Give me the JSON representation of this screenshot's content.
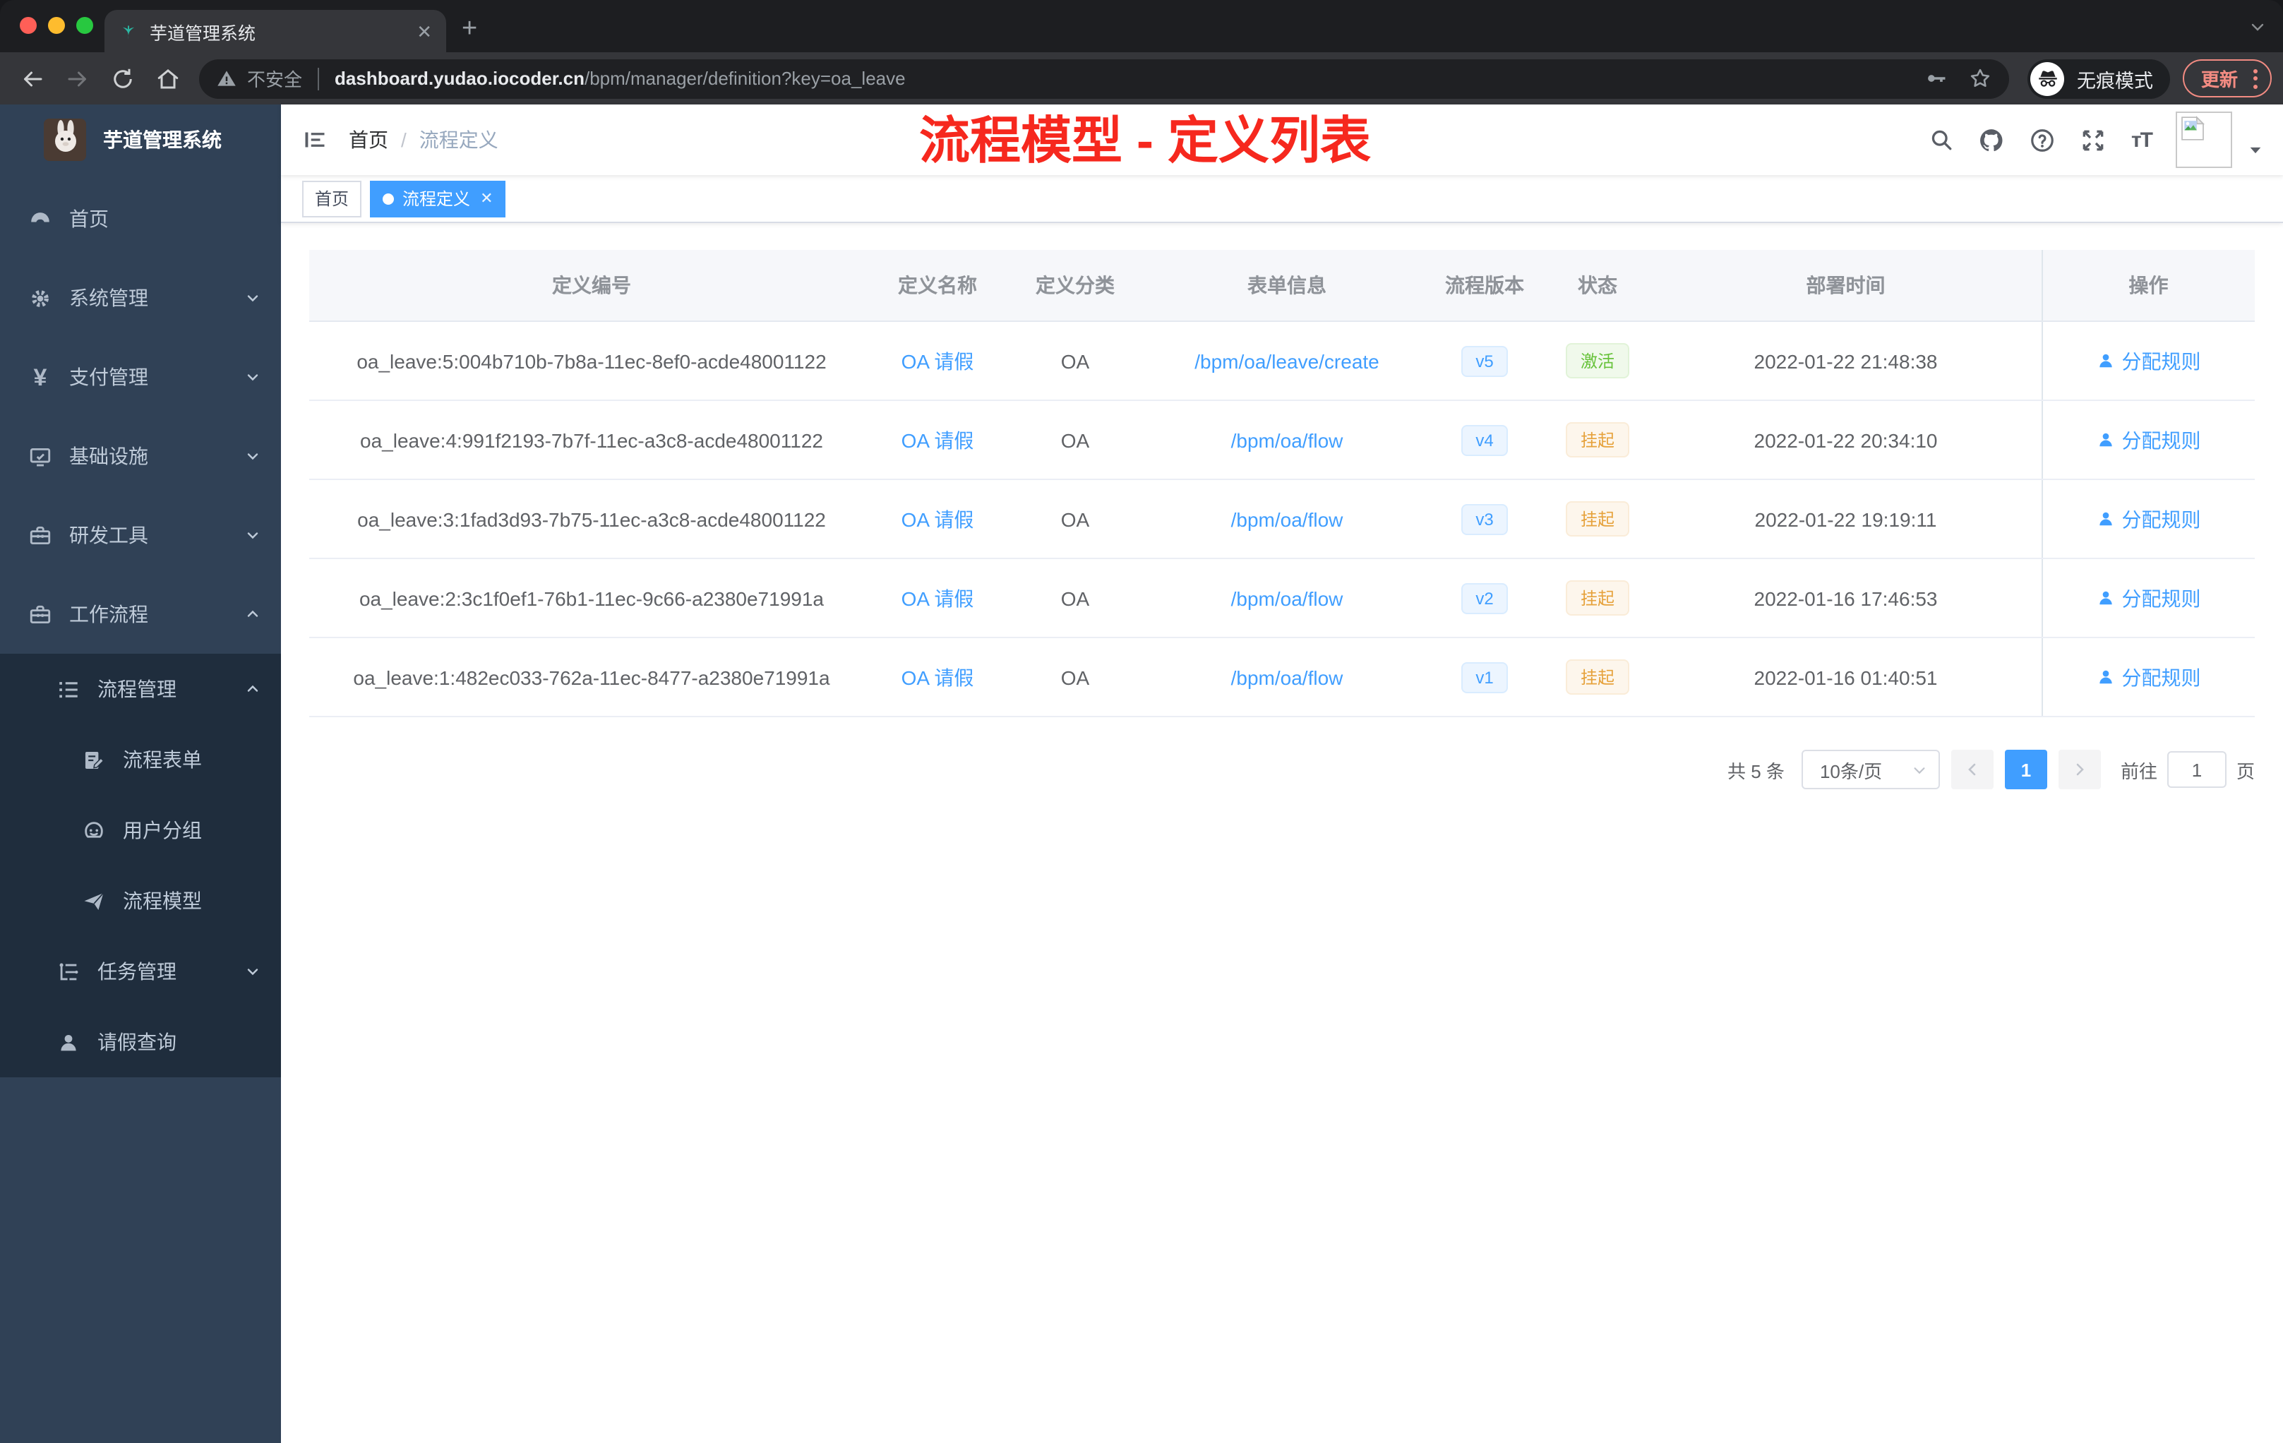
{
  "browser": {
    "tab": {
      "title": "芋道管理系统"
    },
    "toolbar": {
      "security_text": "不安全",
      "url_domain": "dashboard.yudao.iocoder.cn",
      "url_path": "/bpm/manager/definition?key=oa_leave",
      "incognito_label": "无痕模式",
      "update_label": "更新"
    }
  },
  "sidebar": {
    "app_title": "芋道管理系统",
    "items": [
      {
        "key": "home",
        "label": "首页",
        "icon": "dashboard-icon"
      },
      {
        "key": "system",
        "label": "系统管理",
        "icon": "gear-icon",
        "chevron": "down"
      },
      {
        "key": "payment",
        "label": "支付管理",
        "icon": "yen-icon",
        "chevron": "down"
      },
      {
        "key": "infra",
        "label": "基础设施",
        "icon": "monitor-icon",
        "chevron": "down"
      },
      {
        "key": "devtools",
        "label": "研发工具",
        "icon": "toolbox-icon",
        "chevron": "down"
      },
      {
        "key": "workflow",
        "label": "工作流程",
        "icon": "briefcase-icon",
        "chevron": "up"
      }
    ],
    "workflow_children": [
      {
        "key": "process-mgmt",
        "label": "流程管理",
        "icon": "list-icon",
        "chevron": "up",
        "level": 2
      },
      {
        "key": "process-form",
        "label": "流程表单",
        "icon": "form-icon",
        "level": 3
      },
      {
        "key": "user-group",
        "label": "用户分组",
        "icon": "robot-icon",
        "level": 3
      },
      {
        "key": "process-model",
        "label": "流程模型",
        "icon": "plane-icon",
        "level": 3
      },
      {
        "key": "task-mgmt",
        "label": "任务管理",
        "icon": "tree-icon",
        "chevron": "down",
        "level": 2
      },
      {
        "key": "leave-query",
        "label": "请假查询",
        "icon": "user-icon",
        "level": 2
      }
    ]
  },
  "header": {
    "breadcrumb": {
      "home": "首页",
      "separator": "/",
      "current": "流程定义"
    },
    "annotation": "流程模型 - 定义列表",
    "annotation_color": "#f6281e"
  },
  "tags_view": {
    "tabs": [
      {
        "label": "首页",
        "active": false
      },
      {
        "label": "流程定义",
        "active": true,
        "closable": true
      }
    ]
  },
  "table": {
    "columns": [
      "定义编号",
      "定义名称",
      "定义分类",
      "表单信息",
      "流程版本",
      "状态",
      "部署时间",
      "操作"
    ],
    "rows": [
      {
        "id": "oa_leave:5:004b710b-7b8a-11ec-8ef0-acde48001122",
        "name": "OA 请假",
        "category": "OA",
        "form": "/bpm/oa/leave/create",
        "version": "v5",
        "status": "激活",
        "status_type": "success",
        "deploy_time": "2022-01-22 21:48:38",
        "action": "分配规则"
      },
      {
        "id": "oa_leave:4:991f2193-7b7f-11ec-a3c8-acde48001122",
        "name": "OA 请假",
        "category": "OA",
        "form": "/bpm/oa/flow",
        "version": "v4",
        "status": "挂起",
        "status_type": "warning",
        "deploy_time": "2022-01-22 20:34:10",
        "action": "分配规则"
      },
      {
        "id": "oa_leave:3:1fad3d93-7b75-11ec-a3c8-acde48001122",
        "name": "OA 请假",
        "category": "OA",
        "form": "/bpm/oa/flow",
        "version": "v3",
        "status": "挂起",
        "status_type": "warning",
        "deploy_time": "2022-01-22 19:19:11",
        "action": "分配规则"
      },
      {
        "id": "oa_leave:2:3c1f0ef1-76b1-11ec-9c66-a2380e71991a",
        "name": "OA 请假",
        "category": "OA",
        "form": "/bpm/oa/flow",
        "version": "v2",
        "status": "挂起",
        "status_type": "warning",
        "deploy_time": "2022-01-16 17:46:53",
        "action": "分配规则"
      },
      {
        "id": "oa_leave:1:482ec033-762a-11ec-8477-a2380e71991a",
        "name": "OA 请假",
        "category": "OA",
        "form": "/bpm/oa/flow",
        "version": "v1",
        "status": "挂起",
        "status_type": "warning",
        "deploy_time": "2022-01-16 01:40:51",
        "action": "分配规则"
      }
    ]
  },
  "pagination": {
    "total_text": "共 5 条",
    "page_size": "10条/页",
    "current_page": "1",
    "goto_label": "前往",
    "goto_value": "1",
    "page_suffix": "页"
  },
  "colors": {
    "accent_blue": "#409eff",
    "success_green": "#67c23a",
    "warning_orange": "#e6a23c",
    "sidebar_bg": "#304156",
    "submenu_bg": "#1f2d3d",
    "annotation_red": "#f6281e"
  }
}
